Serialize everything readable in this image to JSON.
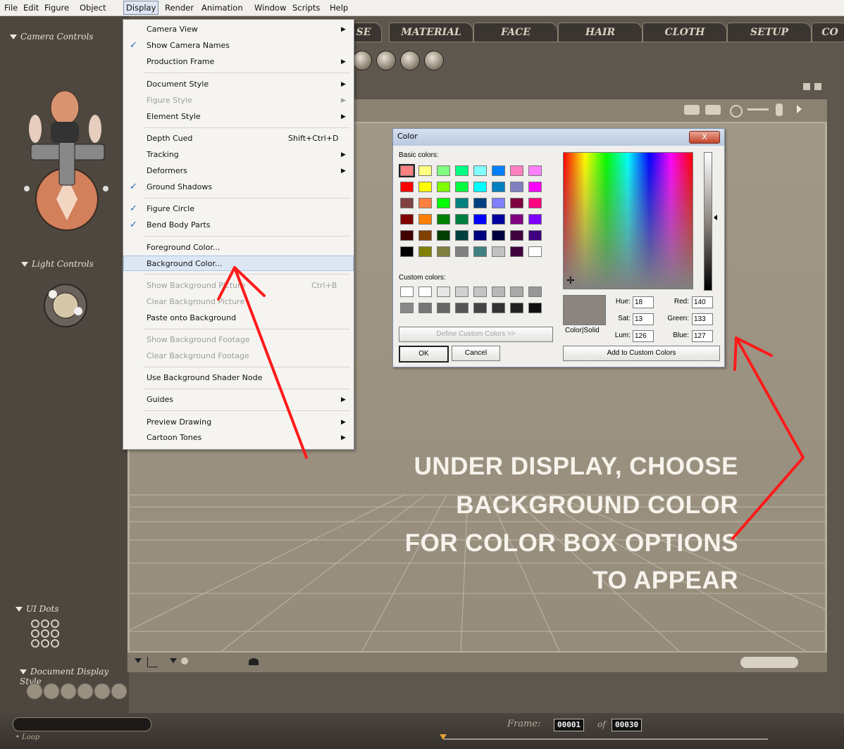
{
  "menubar": {
    "items": [
      "File",
      "Edit",
      "Figure",
      "Object",
      "Display",
      "Render",
      "Animation",
      "Window",
      "Scripts",
      "Help"
    ]
  },
  "left_panel": {
    "camera_controls": "Camera Controls",
    "light_controls": "Light Controls",
    "ui_dots": "UI Dots",
    "document_display_style": "Document Display Style"
  },
  "tabs": [
    "SE",
    "MATERIAL",
    "FACE",
    "HAIR",
    "CLOTH",
    "SETUP",
    "CO"
  ],
  "display_menu": {
    "items": [
      {
        "label": "Camera View",
        "submenu": true
      },
      {
        "label": "Show Camera Names",
        "checked": true
      },
      {
        "label": "Production Frame",
        "submenu": true
      },
      {
        "label": "Document Style",
        "submenu": true
      },
      {
        "label": "Figure Style",
        "submenu": true,
        "disabled": true
      },
      {
        "label": "Element Style",
        "submenu": true
      },
      {
        "label": "Depth Cued",
        "shortcut": "Shift+Ctrl+D"
      },
      {
        "label": "Tracking",
        "submenu": true
      },
      {
        "label": "Deformers",
        "submenu": true
      },
      {
        "label": "Ground Shadows",
        "checked": true
      },
      {
        "label": "Figure Circle",
        "checked": true
      },
      {
        "label": "Bend Body Parts",
        "checked": true
      },
      {
        "label": "Foreground Color..."
      },
      {
        "label": "Background Color...",
        "highlighted": true
      },
      {
        "label": "Show Background Picture",
        "shortcut": "Ctrl+B",
        "disabled": true
      },
      {
        "label": "Clear Background Picture",
        "disabled": true
      },
      {
        "label": "Paste onto Background"
      },
      {
        "label": "Show Background Footage",
        "disabled": true
      },
      {
        "label": "Clear Background Footage",
        "disabled": true
      },
      {
        "label": "Use Background Shader Node"
      },
      {
        "label": "Guides",
        "submenu": true
      },
      {
        "label": "Preview Drawing",
        "submenu": true
      },
      {
        "label": "Cartoon Tones",
        "submenu": true
      }
    ]
  },
  "color_dialog": {
    "title": "Color",
    "close": "X",
    "basic_colors_label": "Basic colors:",
    "custom_colors_label": "Custom colors:",
    "define_custom": "Define Custom Colors >>",
    "ok": "OK",
    "cancel": "Cancel",
    "add_custom": "Add to Custom Colors",
    "color_solid": "Color|Solid",
    "hue_label": "Hue:",
    "hue": "18",
    "sat_label": "Sat:",
    "sat": "13",
    "lum_label": "Lum:",
    "lum": "126",
    "red_label": "Red:",
    "red": "140",
    "green_label": "Green:",
    "green": "133",
    "blue_label": "Blue:",
    "blue": "127",
    "current_color": "#8c857f",
    "basic_colors": [
      "#ff8080",
      "#ffff80",
      "#80ff80",
      "#00ff80",
      "#80ffff",
      "#0080ff",
      "#ff80c0",
      "#ff80ff",
      "#ff0000",
      "#ffff00",
      "#80ff00",
      "#00ff40",
      "#00ffff",
      "#0080c0",
      "#8080c0",
      "#ff00ff",
      "#804040",
      "#ff8040",
      "#00ff00",
      "#008080",
      "#004080",
      "#8080ff",
      "#800040",
      "#ff0080",
      "#800000",
      "#ff8000",
      "#008000",
      "#008040",
      "#0000ff",
      "#0000a0",
      "#800080",
      "#8000ff",
      "#400000",
      "#804000",
      "#004000",
      "#004040",
      "#000080",
      "#000040",
      "#400040",
      "#400080",
      "#000000",
      "#808000",
      "#808040",
      "#808080",
      "#408080",
      "#c0c0c0",
      "#400040",
      "#ffffff"
    ],
    "custom_colors": [
      "#ffffff",
      "#ffffff",
      "#e6e6e6",
      "#d0d0d0",
      "#c4c4c4",
      "#b8b8b8",
      "#a8a8a8",
      "#989898",
      "#888888",
      "#777777",
      "#666666",
      "#555555",
      "#444444",
      "#333333",
      "#222222",
      "#111111"
    ]
  },
  "callout": {
    "lines": [
      "UNDER DISPLAY, CHOOSE",
      "BACKGROUND COLOR",
      "FOR COLOR BOX OPTIONS",
      "TO APPEAR"
    ]
  },
  "bottom_bar": {
    "frame_label": "Frame:",
    "frame_current": "00001",
    "frame_of": "of",
    "frame_total": "00030",
    "loop_label": "Loop"
  },
  "colors": {
    "arrow": "#ff1a1a",
    "accent_check": "#2366b8"
  }
}
